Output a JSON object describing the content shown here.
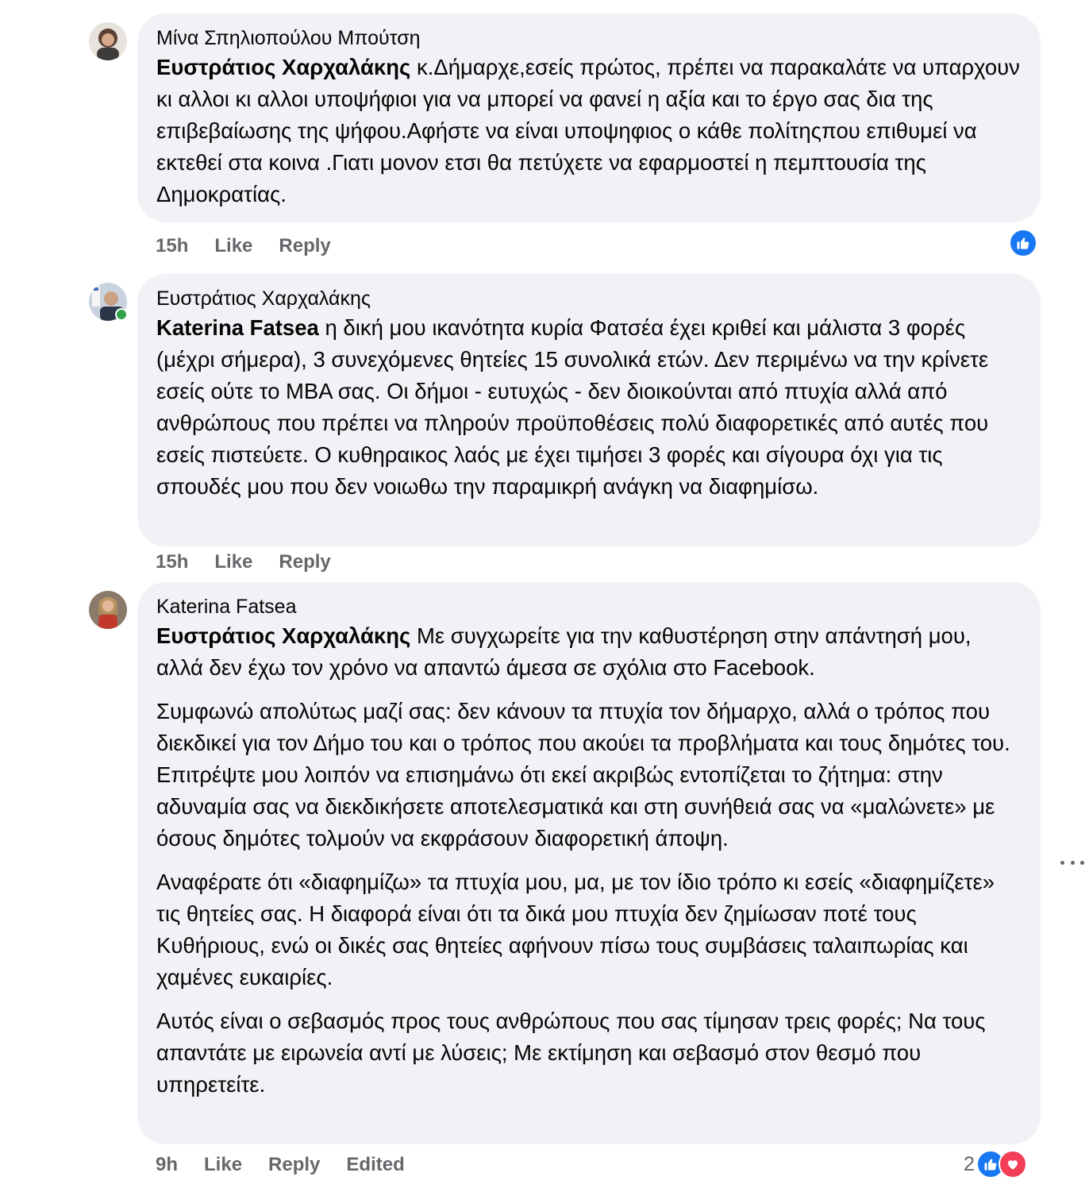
{
  "comments": [
    {
      "author": "Μίνα Σπηλιοπούλου Μπούτση",
      "mention": "Ευστράτιος Χαρχαλάκης",
      "paragraphs": [
        " κ.Δήμαρχε,εσείς πρώτος, πρέπει να παρακαλάτε να υπαρχουν κι αλλοι κι αλλοι υποψήφιοι για να μπορεί να φανεί η αξία και το έργο σας δια της επιβεβαίωσης της ψήφου.Αφήστε να είναι υποψηφιος ο κάθε πολίτηςπου επιθυμεί να εκτεθεί στα κοινα .Γιατι μονον ετσι θα πετύχετε να εφαρμοστεί η πεμπτουσία της Δημοκρατίας."
      ],
      "time": "15h",
      "like_label": "Like",
      "reply_label": "Reply",
      "reactions": [
        "like-icon"
      ]
    },
    {
      "author": "Ευστράτιος Χαρχαλάκης",
      "mention": "Katerina Fatsea",
      "paragraphs": [
        " η δική μου ικανότητα κυρία Φατσέα έχει κριθεί και μάλιστα 3 φορές (μέχρι σήμερα), 3 συνεχόμενες θητείες 15 συνολικά ετών. Δεν περιμένω να την κρίνετε εσείς ούτε το MBA σας. Οι δήμοι - ευτυχώς - δεν διοικούνται από πτυχία αλλά από ανθρώπους που πρέπει να πληρούν προϋποθέσεις πολύ διαφορετικές από αυτές που εσείς πιστεύετε. Ο κυθηραικος λαός με έχει τιμήσει 3 φορές και σίγουρα όχι για τις σπουδές μου που δεν νοιωθω την παραμικρή ανάγκη να διαφημίσω."
      ],
      "time": "15h",
      "like_label": "Like",
      "reply_label": "Reply",
      "online": true
    },
    {
      "author": "Katerina Fatsea",
      "mention": "Ευστράτιος Χαρχαλάκης",
      "paragraphs": [
        " Με συγχωρείτε για την καθυστέρηση στην απάντησή μου, αλλά δεν έχω τον χρόνο να απαντώ άμεσα σε σχόλια στο Facebook.",
        "Συμφωνώ απολύτως μαζί σας: δεν κάνουν τα πτυχία τον δήμαρχο, αλλά ο τρόπος που διεκδικεί για τον Δήμο του και ο τρόπος που ακούει τα προβλήματα και τους δημότες του. Επιτρέψτε μου λοιπόν να επισημάνω ότι εκεί ακριβώς εντοπίζεται το ζήτημα: στην αδυναμία σας να διεκδικήσετε αποτελεσματικά και στη συνήθειά σας να «μαλώνετε» με όσους δημότες τολμούν να εκφράσουν διαφορετική άποψη.",
        "Αναφέρατε ότι «διαφημίζω» τα πτυχία μου, μα, με τον ίδιο τρόπο κι εσείς «διαφημίζετε» τις θητείες σας. Η διαφορά είναι ότι τα δικά μου πτυχία δεν ζημίωσαν ποτέ τους Κυθήριους, ενώ οι δικές σας θητείες αφήνουν πίσω τους συμβάσεις ταλαιπωρίας και χαμένες ευκαιρίες.",
        "Αυτός είναι ο σεβασμός προς τους ανθρώπους που σας τίμησαν τρεις φορές; Να τους απαντάτε με ειρωνεία αντί με λύσεις; Με εκτίμηση και σεβασμό στον θεσμό που υπηρετείτε."
      ],
      "time": "9h",
      "like_label": "Like",
      "reply_label": "Reply",
      "edited_label": "Edited",
      "reaction_count": "2",
      "reactions": [
        "like-icon",
        "love-icon"
      ]
    }
  ],
  "colors": {
    "bubble": "#f0f2f5",
    "meta": "#65676b",
    "like": "#1877f2",
    "love": "#f33e58",
    "online": "#31a24c"
  }
}
